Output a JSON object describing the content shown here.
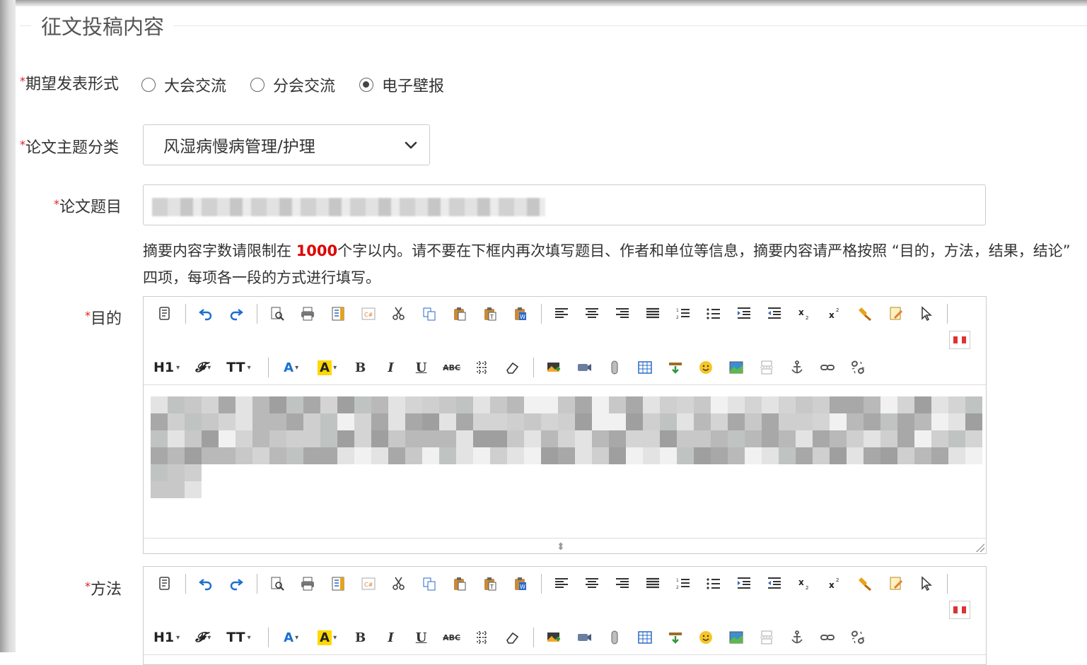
{
  "section_title": "征文投稿内容",
  "presentation": {
    "label": "期望发表形式",
    "options": [
      "大会交流",
      "分会交流",
      "电子壁报"
    ],
    "selected_index": 2
  },
  "category": {
    "label": "论文主题分类",
    "value": "风湿病慢病管理/护理"
  },
  "paper_title": {
    "label": "论文题目"
  },
  "hint": {
    "before": "摘要内容字数请限制在 ",
    "limit": "1000",
    "after": "个字以内。请不要在下框内再次填写题目、作者和单位等信息，摘要内容请严格按照 “目的，方法，结果，结论” 四项，每项各一段的方式进行填写。"
  },
  "editors": [
    {
      "label": "目的"
    },
    {
      "label": "方法"
    }
  ],
  "toolbar": {
    "heading": "H1",
    "font_family": "𝓕",
    "font_size": "TT",
    "font_color": "A",
    "bg_color": "A",
    "bold": "B",
    "italic": "I",
    "underline": "U",
    "strike": "ABC"
  },
  "colors": {
    "required_star": "#e02020",
    "limit_red": "#e00000",
    "icon_blue": "#1a6fd1",
    "highlight_yellow": "#ffd800"
  }
}
